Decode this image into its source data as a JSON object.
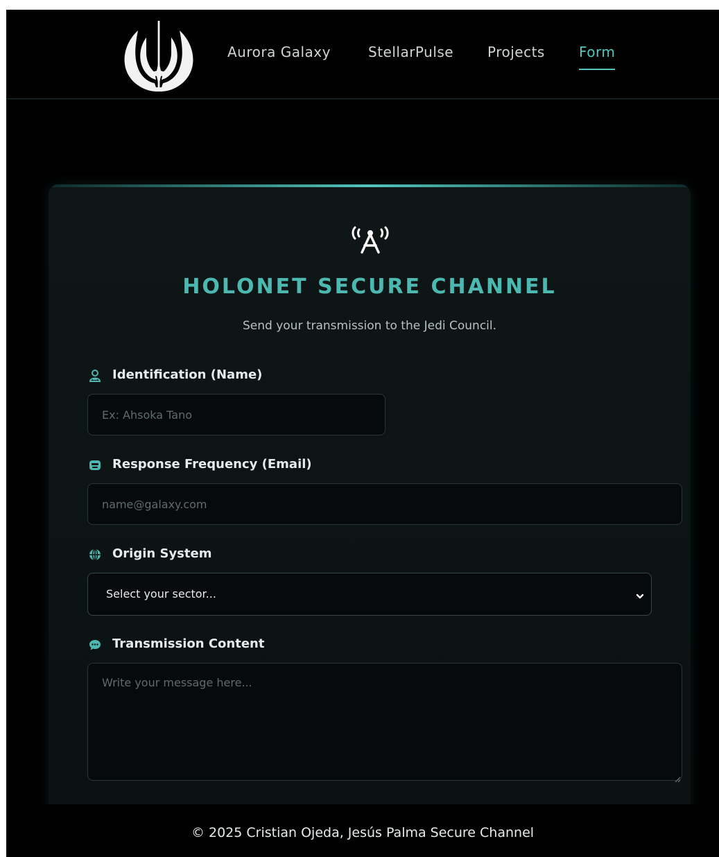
{
  "navbar": {
    "logo_icon": "jedi-order-emblem-icon",
    "links": [
      {
        "label": "Aurora Galaxy",
        "active": false
      },
      {
        "label": "StellarPulse",
        "active": false
      },
      {
        "label": "Projects",
        "active": false
      },
      {
        "label": "Form",
        "active": true
      }
    ]
  },
  "form": {
    "header_icon": "antenna-broadcast-icon",
    "title": "HOLONET SECURE CHANNEL",
    "subtitle": "Send your transmission to the Jedi Council.",
    "fields": {
      "name": {
        "icon": "user-icon",
        "label": "Identification (Name)",
        "placeholder": "Ex: Ahsoka Tano",
        "value": ""
      },
      "email": {
        "icon": "robot-icon",
        "label": "Response Frequency (Email)",
        "placeholder": "name@galaxy.com",
        "value": ""
      },
      "origin": {
        "icon": "globe-icon",
        "label": "Origin System",
        "selected": "Select your sector..."
      },
      "message": {
        "icon": "speech-bubble-icon",
        "label": "Transmission Content",
        "placeholder": "Write your message here...",
        "value": ""
      }
    }
  },
  "footer": {
    "text": "© 2025 Cristian Ojeda, Jesús Palma   Secure Channel"
  },
  "colors": {
    "accent": "#53c6bd",
    "title": "#4db8b0",
    "background": "#000000",
    "card": "#0e1616"
  }
}
